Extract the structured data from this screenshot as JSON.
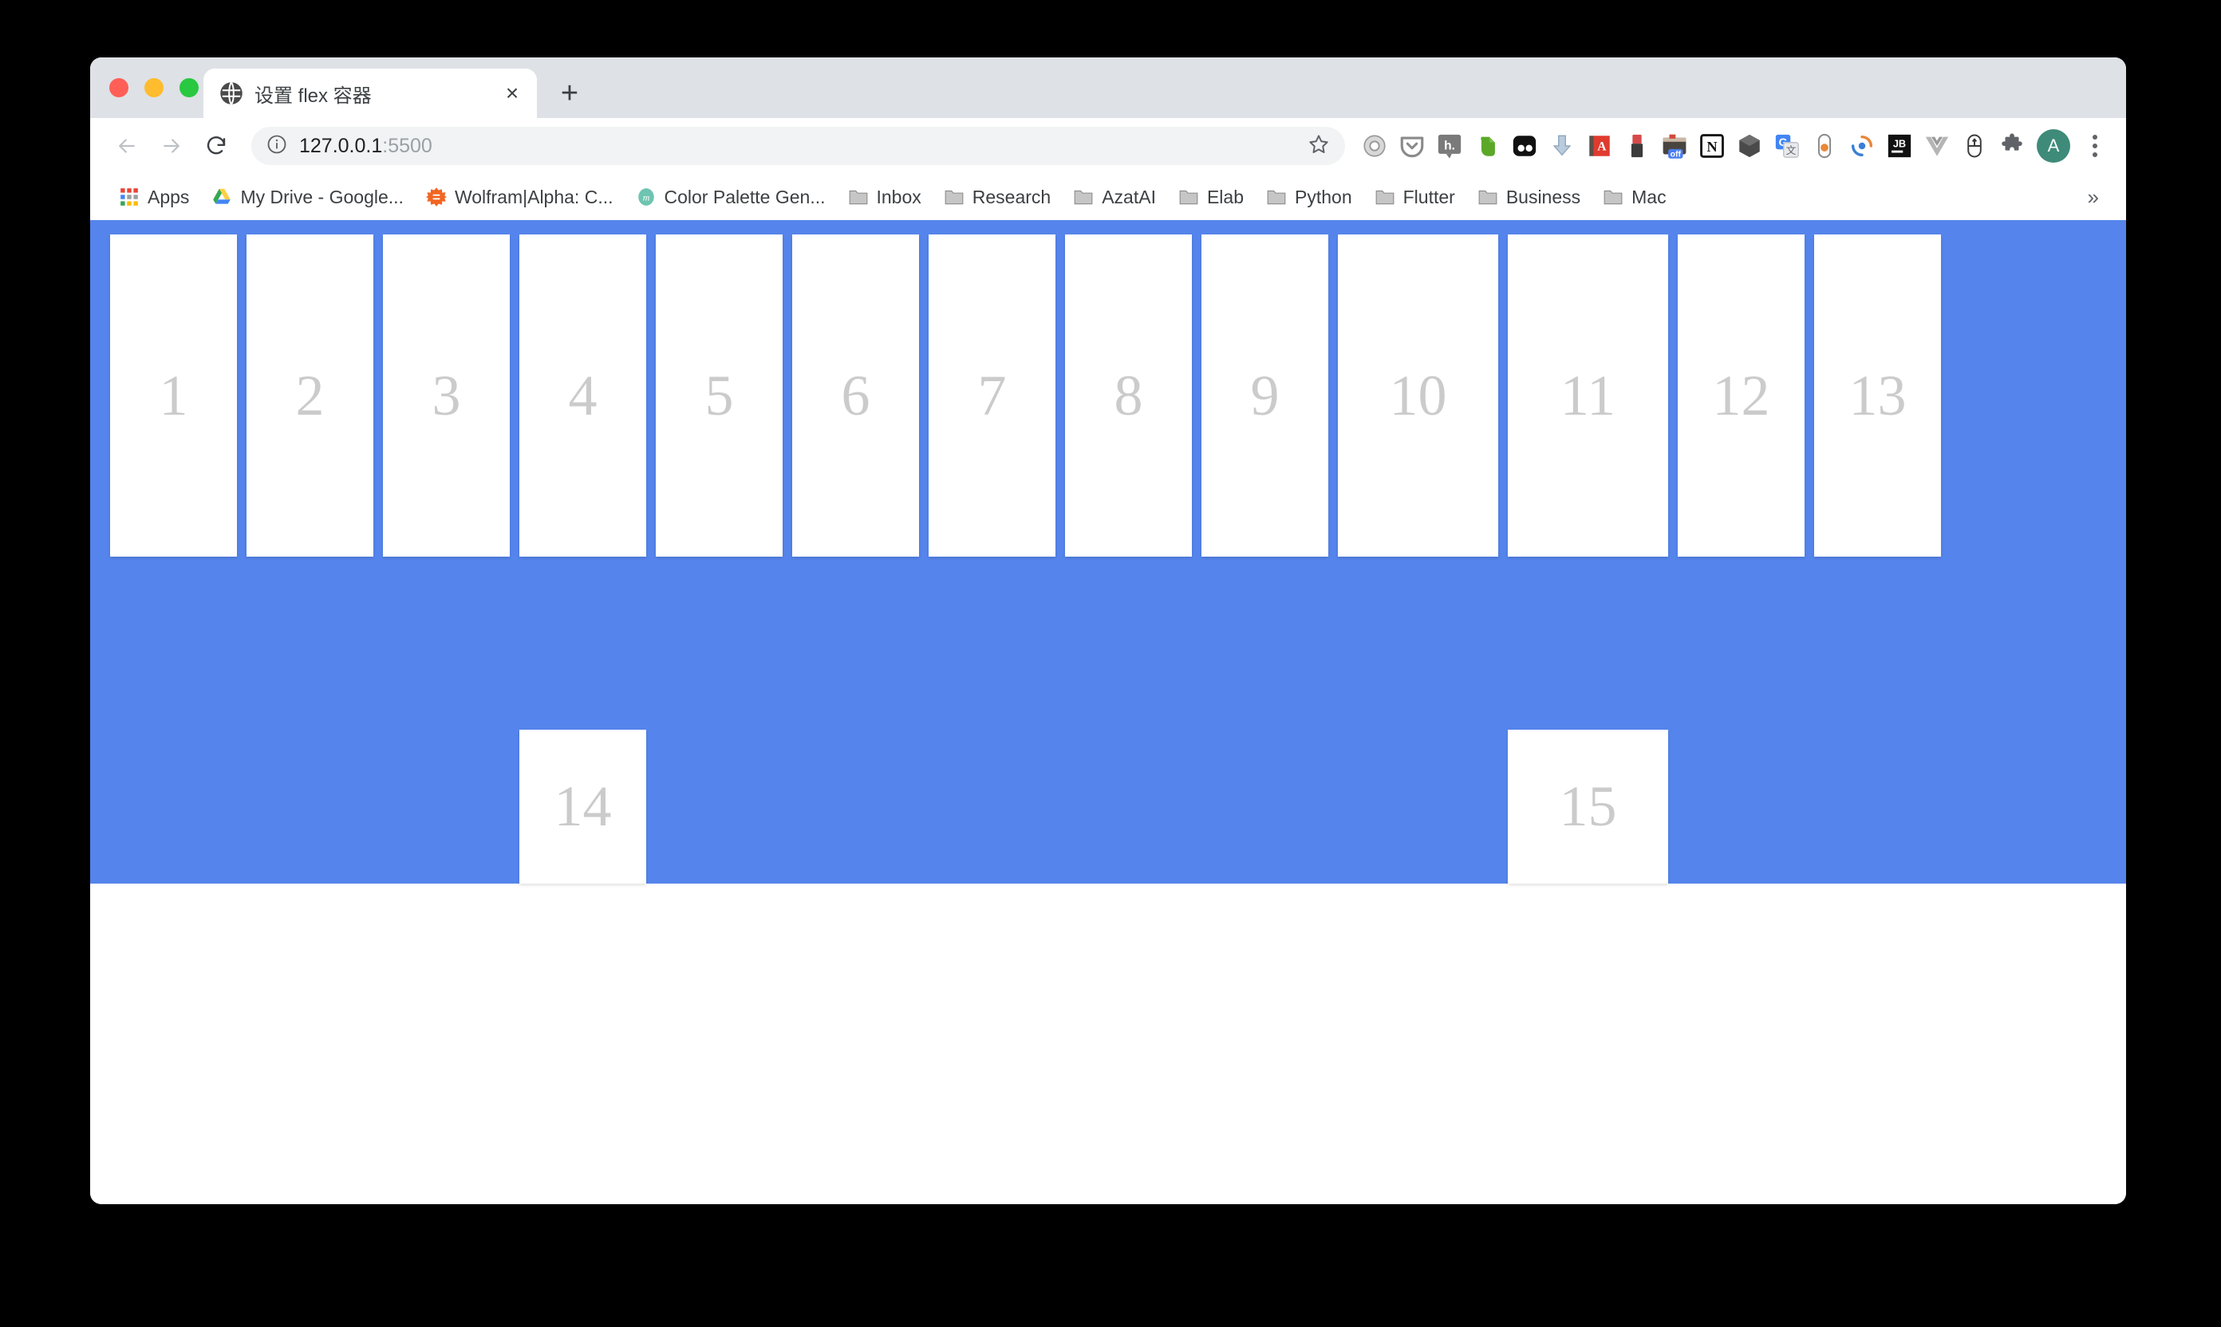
{
  "window": {
    "traffic_lights": [
      "close",
      "minimize",
      "zoom"
    ]
  },
  "tab": {
    "title": "设置 flex 容器",
    "favicon": "globe-icon",
    "close_label": "×",
    "new_tab_label": "+"
  },
  "toolbar": {
    "back_label": "←",
    "forward_label": "→",
    "reload_label": "⟳",
    "url_host": "127.0.0.1",
    "url_port": ":5500",
    "url_full": "127.0.0.1:5500",
    "info_icon": "info-circle-icon",
    "bookmark_star": "star-icon",
    "extensions": [
      {
        "name": "gear-extension-icon",
        "label": ""
      },
      {
        "name": "pocket-extension-icon",
        "label": ""
      },
      {
        "name": "hypothesis-extension-icon",
        "label": "h."
      },
      {
        "name": "evernote-extension-icon",
        "label": ""
      },
      {
        "name": "flickr-extension-icon",
        "label": ""
      },
      {
        "name": "download-extension-icon",
        "label": ""
      },
      {
        "name": "dictionary-extension-icon",
        "label": "A"
      },
      {
        "name": "lipstick-extension-icon",
        "label": ""
      },
      {
        "name": "toolbox-off-extension-icon",
        "label": "off"
      },
      {
        "name": "notion-extension-icon",
        "label": "N"
      },
      {
        "name": "cube-extension-icon",
        "label": ""
      },
      {
        "name": "google-translate-extension-icon",
        "label": "G"
      },
      {
        "name": "capsule-extension-icon",
        "label": ""
      },
      {
        "name": "sync-extension-icon",
        "label": ""
      },
      {
        "name": "jetbrains-extension-icon",
        "label": "JB"
      },
      {
        "name": "vue-extension-icon",
        "label": ""
      },
      {
        "name": "mouse-extension-icon",
        "label": ""
      },
      {
        "name": "puzzle-extensions-icon",
        "label": ""
      }
    ],
    "avatar_initial": "A",
    "menu_label": "kebab-menu"
  },
  "bookmarks": {
    "overflow_label": "»",
    "items": [
      {
        "label": "Apps",
        "icon": "apps-grid-icon"
      },
      {
        "label": "My Drive - Google...",
        "icon": "google-drive-icon"
      },
      {
        "label": "Wolfram|Alpha: C...",
        "icon": "wolfram-alpha-icon"
      },
      {
        "label": "Color Palette Gen...",
        "icon": "coolors-icon"
      },
      {
        "label": "Inbox",
        "icon": "folder-icon"
      },
      {
        "label": "Research",
        "icon": "folder-icon"
      },
      {
        "label": "AzatAI",
        "icon": "folder-icon"
      },
      {
        "label": "Elab",
        "icon": "folder-icon"
      },
      {
        "label": "Python",
        "icon": "folder-icon"
      },
      {
        "label": "Flutter",
        "icon": "folder-icon"
      },
      {
        "label": "Business",
        "icon": "folder-icon"
      },
      {
        "label": "Mac",
        "icon": "folder-icon"
      }
    ]
  },
  "page": {
    "container_color": "#5585ec",
    "item_color": "#ffffff",
    "item_text_color": "#cbcbcb",
    "items": [
      {
        "label": "1",
        "size": "short"
      },
      {
        "label": "2",
        "size": "short"
      },
      {
        "label": "3",
        "size": "short"
      },
      {
        "label": "4",
        "size": "short"
      },
      {
        "label": "5",
        "size": "short"
      },
      {
        "label": "6",
        "size": "short"
      },
      {
        "label": "7",
        "size": "short"
      },
      {
        "label": "8",
        "size": "short"
      },
      {
        "label": "9",
        "size": "short"
      },
      {
        "label": "10",
        "size": "wide"
      },
      {
        "label": "11",
        "size": "wide"
      },
      {
        "label": "12",
        "size": "short"
      },
      {
        "label": "13",
        "size": "short"
      },
      {
        "label": "14",
        "size": "tall"
      },
      {
        "label": "15",
        "size": "tall"
      }
    ]
  }
}
